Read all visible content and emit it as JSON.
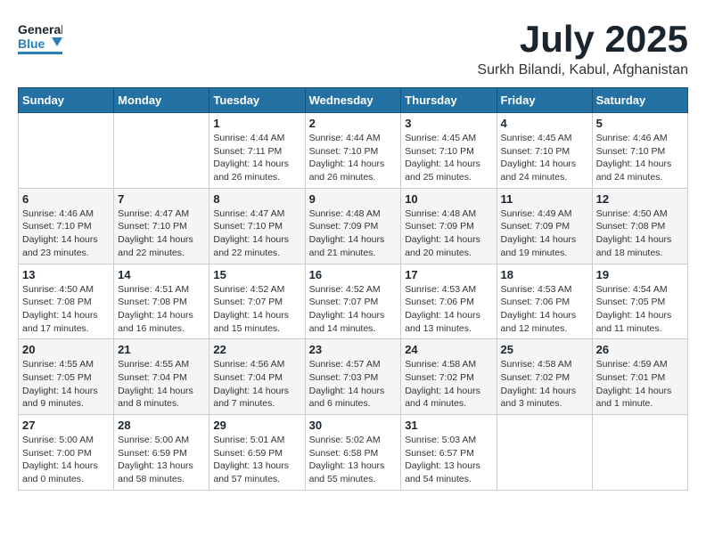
{
  "header": {
    "logo_general": "General",
    "logo_blue": "Blue",
    "month": "July 2025",
    "location": "Surkh Bilandi, Kabul, Afghanistan"
  },
  "weekdays": [
    "Sunday",
    "Monday",
    "Tuesday",
    "Wednesday",
    "Thursday",
    "Friday",
    "Saturday"
  ],
  "weeks": [
    [
      {
        "day": "",
        "info": ""
      },
      {
        "day": "",
        "info": ""
      },
      {
        "day": "1",
        "info": "Sunrise: 4:44 AM\nSunset: 7:11 PM\nDaylight: 14 hours\nand 26 minutes."
      },
      {
        "day": "2",
        "info": "Sunrise: 4:44 AM\nSunset: 7:10 PM\nDaylight: 14 hours\nand 26 minutes."
      },
      {
        "day": "3",
        "info": "Sunrise: 4:45 AM\nSunset: 7:10 PM\nDaylight: 14 hours\nand 25 minutes."
      },
      {
        "day": "4",
        "info": "Sunrise: 4:45 AM\nSunset: 7:10 PM\nDaylight: 14 hours\nand 24 minutes."
      },
      {
        "day": "5",
        "info": "Sunrise: 4:46 AM\nSunset: 7:10 PM\nDaylight: 14 hours\nand 24 minutes."
      }
    ],
    [
      {
        "day": "6",
        "info": "Sunrise: 4:46 AM\nSunset: 7:10 PM\nDaylight: 14 hours\nand 23 minutes."
      },
      {
        "day": "7",
        "info": "Sunrise: 4:47 AM\nSunset: 7:10 PM\nDaylight: 14 hours\nand 22 minutes."
      },
      {
        "day": "8",
        "info": "Sunrise: 4:47 AM\nSunset: 7:10 PM\nDaylight: 14 hours\nand 22 minutes."
      },
      {
        "day": "9",
        "info": "Sunrise: 4:48 AM\nSunset: 7:09 PM\nDaylight: 14 hours\nand 21 minutes."
      },
      {
        "day": "10",
        "info": "Sunrise: 4:48 AM\nSunset: 7:09 PM\nDaylight: 14 hours\nand 20 minutes."
      },
      {
        "day": "11",
        "info": "Sunrise: 4:49 AM\nSunset: 7:09 PM\nDaylight: 14 hours\nand 19 minutes."
      },
      {
        "day": "12",
        "info": "Sunrise: 4:50 AM\nSunset: 7:08 PM\nDaylight: 14 hours\nand 18 minutes."
      }
    ],
    [
      {
        "day": "13",
        "info": "Sunrise: 4:50 AM\nSunset: 7:08 PM\nDaylight: 14 hours\nand 17 minutes."
      },
      {
        "day": "14",
        "info": "Sunrise: 4:51 AM\nSunset: 7:08 PM\nDaylight: 14 hours\nand 16 minutes."
      },
      {
        "day": "15",
        "info": "Sunrise: 4:52 AM\nSunset: 7:07 PM\nDaylight: 14 hours\nand 15 minutes."
      },
      {
        "day": "16",
        "info": "Sunrise: 4:52 AM\nSunset: 7:07 PM\nDaylight: 14 hours\nand 14 minutes."
      },
      {
        "day": "17",
        "info": "Sunrise: 4:53 AM\nSunset: 7:06 PM\nDaylight: 14 hours\nand 13 minutes."
      },
      {
        "day": "18",
        "info": "Sunrise: 4:53 AM\nSunset: 7:06 PM\nDaylight: 14 hours\nand 12 minutes."
      },
      {
        "day": "19",
        "info": "Sunrise: 4:54 AM\nSunset: 7:05 PM\nDaylight: 14 hours\nand 11 minutes."
      }
    ],
    [
      {
        "day": "20",
        "info": "Sunrise: 4:55 AM\nSunset: 7:05 PM\nDaylight: 14 hours\nand 9 minutes."
      },
      {
        "day": "21",
        "info": "Sunrise: 4:55 AM\nSunset: 7:04 PM\nDaylight: 14 hours\nand 8 minutes."
      },
      {
        "day": "22",
        "info": "Sunrise: 4:56 AM\nSunset: 7:04 PM\nDaylight: 14 hours\nand 7 minutes."
      },
      {
        "day": "23",
        "info": "Sunrise: 4:57 AM\nSunset: 7:03 PM\nDaylight: 14 hours\nand 6 minutes."
      },
      {
        "day": "24",
        "info": "Sunrise: 4:58 AM\nSunset: 7:02 PM\nDaylight: 14 hours\nand 4 minutes."
      },
      {
        "day": "25",
        "info": "Sunrise: 4:58 AM\nSunset: 7:02 PM\nDaylight: 14 hours\nand 3 minutes."
      },
      {
        "day": "26",
        "info": "Sunrise: 4:59 AM\nSunset: 7:01 PM\nDaylight: 14 hours\nand 1 minute."
      }
    ],
    [
      {
        "day": "27",
        "info": "Sunrise: 5:00 AM\nSunset: 7:00 PM\nDaylight: 14 hours\nand 0 minutes."
      },
      {
        "day": "28",
        "info": "Sunrise: 5:00 AM\nSunset: 6:59 PM\nDaylight: 13 hours\nand 58 minutes."
      },
      {
        "day": "29",
        "info": "Sunrise: 5:01 AM\nSunset: 6:59 PM\nDaylight: 13 hours\nand 57 minutes."
      },
      {
        "day": "30",
        "info": "Sunrise: 5:02 AM\nSunset: 6:58 PM\nDaylight: 13 hours\nand 55 minutes."
      },
      {
        "day": "31",
        "info": "Sunrise: 5:03 AM\nSunset: 6:57 PM\nDaylight: 13 hours\nand 54 minutes."
      },
      {
        "day": "",
        "info": ""
      },
      {
        "day": "",
        "info": ""
      }
    ]
  ]
}
